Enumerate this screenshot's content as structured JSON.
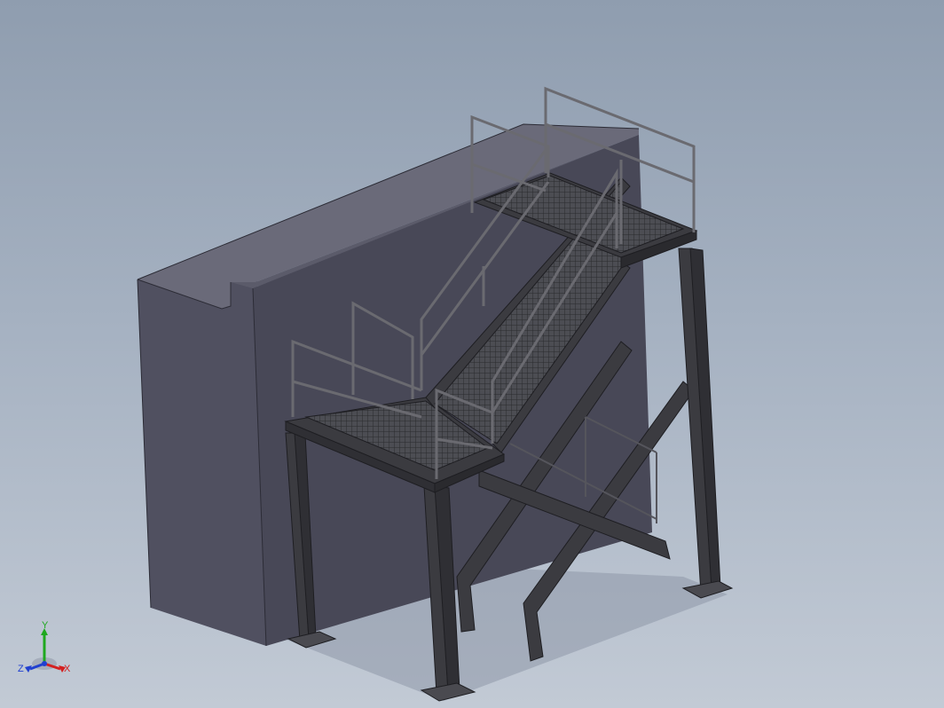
{
  "viewport": {
    "background_top": "#8f9daf",
    "background_bottom": "#c2cad5"
  },
  "model": {
    "wall_front_color": "#4a4a58",
    "wall_side_color": "#565665",
    "wall_top_color": "#6b6b7a",
    "steel_color": "#3a3a3e",
    "steel_edge_color": "#1e1e22",
    "grating_color": "#55565c"
  },
  "triad": {
    "x_label": "X",
    "y_label": "Y",
    "z_label": "Z",
    "x_color": "#d42020",
    "y_color": "#1fa81f",
    "z_color": "#2040d0"
  }
}
